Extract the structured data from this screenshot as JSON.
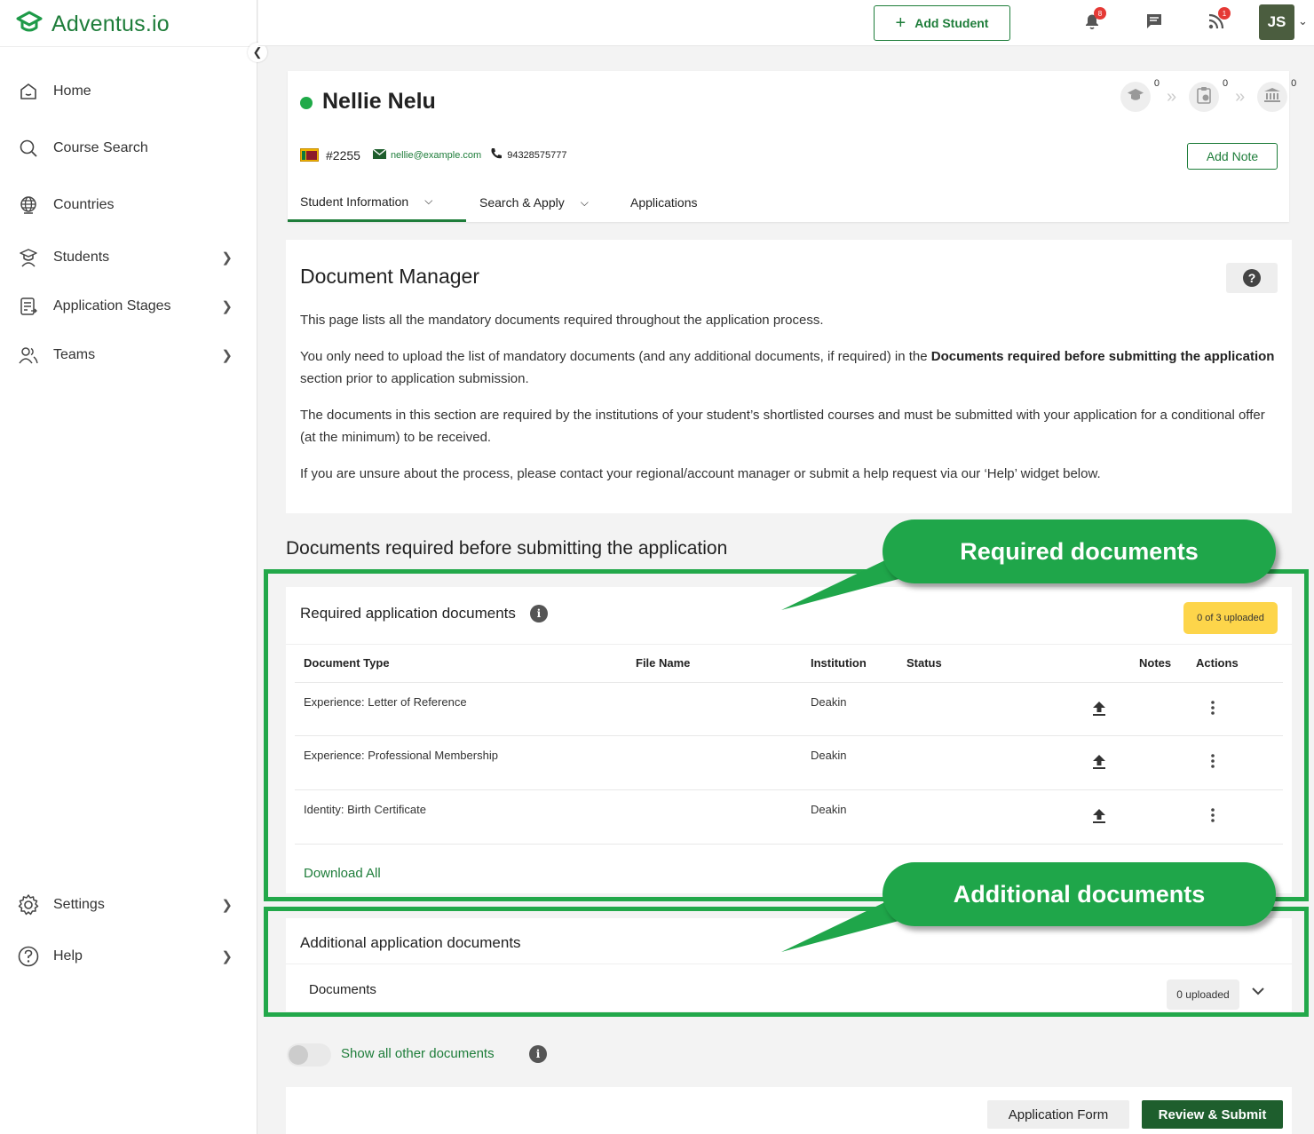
{
  "brand": {
    "name": "Adventus.io"
  },
  "sidebar": {
    "items": [
      {
        "label": "Home",
        "icon": "home-icon"
      },
      {
        "label": "Course Search",
        "icon": "search-icon"
      },
      {
        "label": "Countries",
        "icon": "globe-icon"
      },
      {
        "label": "Students",
        "icon": "student-icon",
        "chevron": ">"
      },
      {
        "label": "Application Stages",
        "icon": "document-icon",
        "chevron": ">"
      },
      {
        "label": "Teams",
        "icon": "team-icon",
        "chevron": ">"
      }
    ],
    "bottom_items": [
      {
        "label": "Settings",
        "icon": "gear-icon",
        "chevron": ">"
      },
      {
        "label": "Help",
        "icon": "help-icon",
        "chevron": ">"
      }
    ]
  },
  "topbar": {
    "add_student": "Add Student",
    "notifications_count": "8",
    "feed_count": "1",
    "avatar_initials": "JS"
  },
  "student": {
    "name": "Nellie Nelu",
    "id": "#2255",
    "email": "nellie@example.com",
    "phone": "94328575777",
    "progress_counts": [
      "0",
      "0",
      "0"
    ],
    "add_note": "Add Note",
    "tabs": [
      "Student Information",
      "Search & Apply",
      "Applications"
    ]
  },
  "doc_manager": {
    "title": "Document Manager",
    "p1": "This page lists all the mandatory documents required throughout the application process.",
    "p2_start": "You only need to upload the list of mandatory documents (and any additional documents, if required) in the ",
    "p2_bold": "Documents required before submitting the application",
    "p2_end": " section prior to application submission.",
    "p3": "The documents in this section are required by the institutions of your student’s shortlisted courses and must be submitted with your application for a conditional offer (at the minimum) to be received.",
    "p4": "If you are unsure about the process, please contact your regional/account manager or submit a help request via our ‘Help’ widget below."
  },
  "required_section": {
    "heading": "Documents required before submitting the application",
    "title": "Required application documents",
    "uploaded": "0 of 3 uploaded",
    "columns": [
      "Document Type",
      "File Name",
      "Institution",
      "Status",
      "Notes",
      "Actions"
    ],
    "rows": [
      {
        "type": "Experience: Letter of Reference",
        "file": "",
        "institution": "Deakin",
        "status": ""
      },
      {
        "type": "Experience: Professional Membership",
        "file": "",
        "institution": "Deakin",
        "status": ""
      },
      {
        "type": "Identity: Birth Certificate",
        "file": "",
        "institution": "Deakin",
        "status": ""
      }
    ],
    "download_all": "Download All"
  },
  "additional_section": {
    "title": "Additional application documents",
    "documents_label": "Documents",
    "uploaded": "0 uploaded"
  },
  "toggle": {
    "label": "Show all other documents",
    "on": false
  },
  "footer": {
    "application_form": "Application Form",
    "review_submit": "Review & Submit"
  },
  "annotations": {
    "required": "Required documents",
    "additional": "Additional documents",
    "color": "#22a84a"
  }
}
